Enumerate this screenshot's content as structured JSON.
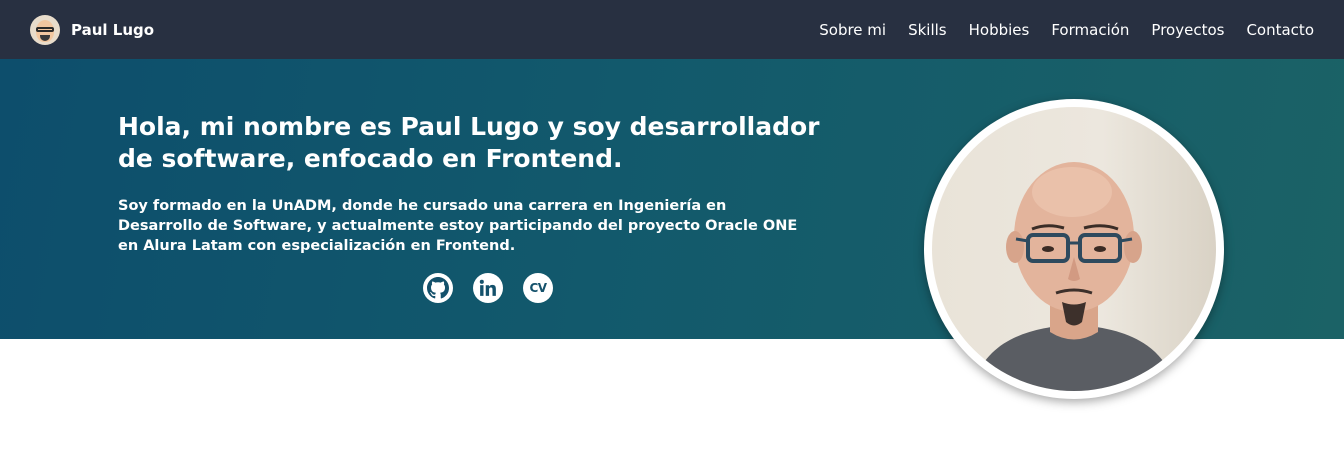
{
  "navbar": {
    "brand_name": "Paul Lugo",
    "links": [
      {
        "label": "Sobre mi"
      },
      {
        "label": "Skills"
      },
      {
        "label": "Hobbies"
      },
      {
        "label": "Formación"
      },
      {
        "label": "Proyectos"
      },
      {
        "label": "Contacto"
      }
    ]
  },
  "hero": {
    "title": "Hola, mi nombre es Paul Lugo y soy desarrollador de software, enfocado en Frontend.",
    "description": "Soy formado en la UnADM, donde he cursado una carrera en Ingeniería en Desarrollo de Software, y actualmente estoy participando del proyecto Oracle ONE en Alura Latam con especialización en Frontend.",
    "socials": [
      {
        "icon": "github-icon"
      },
      {
        "icon": "linkedin-icon"
      },
      {
        "icon": "cv-icon",
        "text": "CV"
      }
    ]
  },
  "colors": {
    "navbar_bg": "#283041",
    "hero_gradient_start": "#0d4e6c",
    "hero_gradient_end": "#1b6266",
    "text": "#ffffff"
  }
}
